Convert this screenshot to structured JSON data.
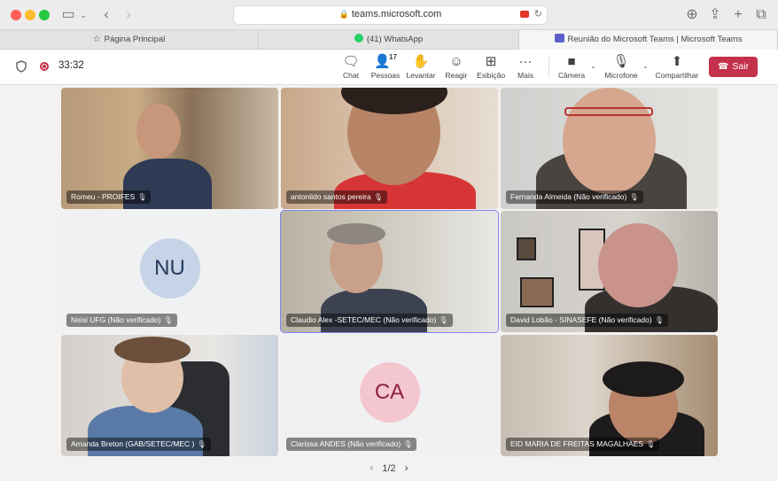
{
  "browser": {
    "url": "teams.microsoft.com",
    "tabs": [
      {
        "label": "Página Principal",
        "icon": "star-icon"
      },
      {
        "label": "(41) WhatsApp",
        "icon": "whatsapp-icon"
      },
      {
        "label": "Reunião do Microsoft Teams | Microsoft Teams",
        "icon": "teams-icon"
      }
    ]
  },
  "meeting": {
    "timer": "33:32",
    "people_count": "17",
    "toolbar": {
      "chat": "Chat",
      "people": "Pessoas",
      "raise": "Levantar",
      "react": "Reagir",
      "view": "Exibição",
      "more": "Mais",
      "camera": "Câmera",
      "mic": "Microfone",
      "share": "Compartilhar",
      "leave": "Sair"
    },
    "participants": [
      {
        "name": "Romeu - PROIFES",
        "type": "video"
      },
      {
        "name": "antonildo santos pereira",
        "type": "video"
      },
      {
        "name": "Fernanda Almeida (Não verificado)",
        "type": "video"
      },
      {
        "name": "Neisi UFG (Não verificado)",
        "type": "avatar",
        "initials": "NU"
      },
      {
        "name": "Claudio Alex -SETEC/MEC (Não verificado)",
        "type": "video",
        "speaking": true
      },
      {
        "name": "David Lobão - SINASEFE (Não verificado)",
        "type": "video"
      },
      {
        "name": "Amanda Breton (GAB/SETEC/MEC )",
        "type": "video"
      },
      {
        "name": "Clarissa ANDES (Não verificado)",
        "type": "avatar",
        "initials": "CA"
      },
      {
        "name": "EID MARIA DE FREITAS MAGALHAES",
        "type": "video"
      }
    ],
    "pager": "1/2"
  }
}
